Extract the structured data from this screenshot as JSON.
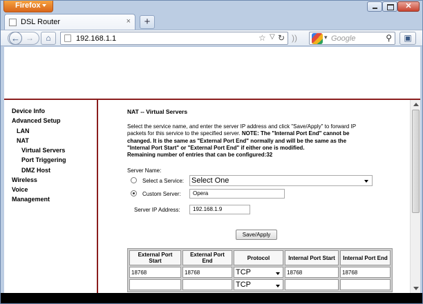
{
  "browser": {
    "menu_label": "Firefox",
    "tab_title": "DSL Router",
    "new_tab_glyph": "+",
    "url": "192.168.1.1",
    "search_placeholder": "Google",
    "icons": [
      "back-icon",
      "forward-icon",
      "home-icon",
      "star-icon",
      "reload-icon",
      "rss-icon",
      "google-icon",
      "search-icon",
      "bookmarks-icon"
    ]
  },
  "sidebar": {
    "items": [
      {
        "label": "Device Info"
      },
      {
        "label": "Advanced Setup"
      },
      {
        "label": "LAN"
      },
      {
        "label": "NAT"
      },
      {
        "label": "Virtual Servers"
      },
      {
        "label": "Port Triggering"
      },
      {
        "label": "DMZ Host"
      },
      {
        "label": "Wireless"
      },
      {
        "label": "Voice"
      },
      {
        "label": "Management"
      }
    ]
  },
  "main": {
    "heading": "NAT -- Virtual Servers",
    "desc_line1": "Select the service name, and enter the server IP address and click \"Save/Apply\" to forward IP",
    "desc_line2_plain": "packets for this service to the specified server. ",
    "desc_line2_bold": "NOTE: The \"Internal Port End\" cannot be",
    "desc_line3": "changed. It is the same as \"External Port End\" normally and will be the same as the",
    "desc_line4": "\"Internal Port Start\" or \"External Port End\" if either one is modified.",
    "remaining": "Remaining number of entries that can be configured:32",
    "server_name_label": "Server Name:",
    "select_service_label": "Select a Service:",
    "select_service_value": "Select One",
    "custom_server_label": "Custom Server:",
    "custom_server_value": "Opera",
    "server_ip_label": "Server IP Address:",
    "server_ip_value": "192.168.1.9",
    "save_label": "Save/Apply",
    "table": {
      "headers": [
        "External Port Start",
        "External Port End",
        "Protocol",
        "Internal Port Start",
        "Internal Port End"
      ],
      "rows": [
        [
          "18768",
          "18768",
          "TCP",
          "18768",
          "18768"
        ],
        [
          "",
          "",
          "TCP",
          "",
          ""
        ]
      ]
    }
  },
  "colors": {
    "accent_line": "#8a1c1c",
    "firefox_button": "#e07a22"
  }
}
